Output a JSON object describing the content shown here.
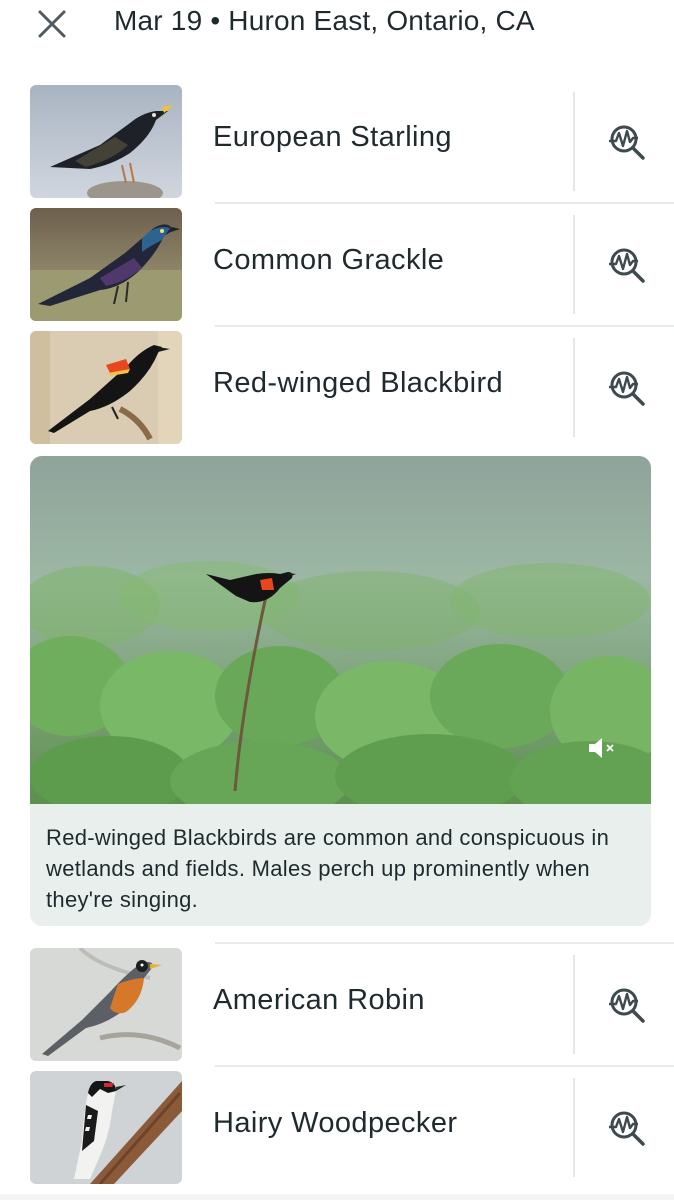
{
  "header": {
    "title": "Mar 19 • Huron East, Ontario, CA",
    "close_icon": "close-icon"
  },
  "birds": [
    {
      "name": "European Starling",
      "icon": "sound-id-search-icon"
    },
    {
      "name": "Common Grackle",
      "icon": "sound-id-search-icon"
    },
    {
      "name": "Red-winged Blackbird",
      "icon": "sound-id-search-icon"
    },
    {
      "name": "American Robin",
      "icon": "sound-id-search-icon"
    },
    {
      "name": "Hairy Woodpecker",
      "icon": "sound-id-search-icon"
    }
  ],
  "expanded_card": {
    "description": "Red-winged Blackbirds are common and conspicuous in wetlands and fields. Males perch up prominently when they're singing.",
    "mute_icon": "speaker-muted-icon"
  },
  "colors": {
    "text": "#1f2a2e",
    "icon": "#3e4a4e",
    "divider": "#e4ebea",
    "card_background": "#e9efed"
  }
}
